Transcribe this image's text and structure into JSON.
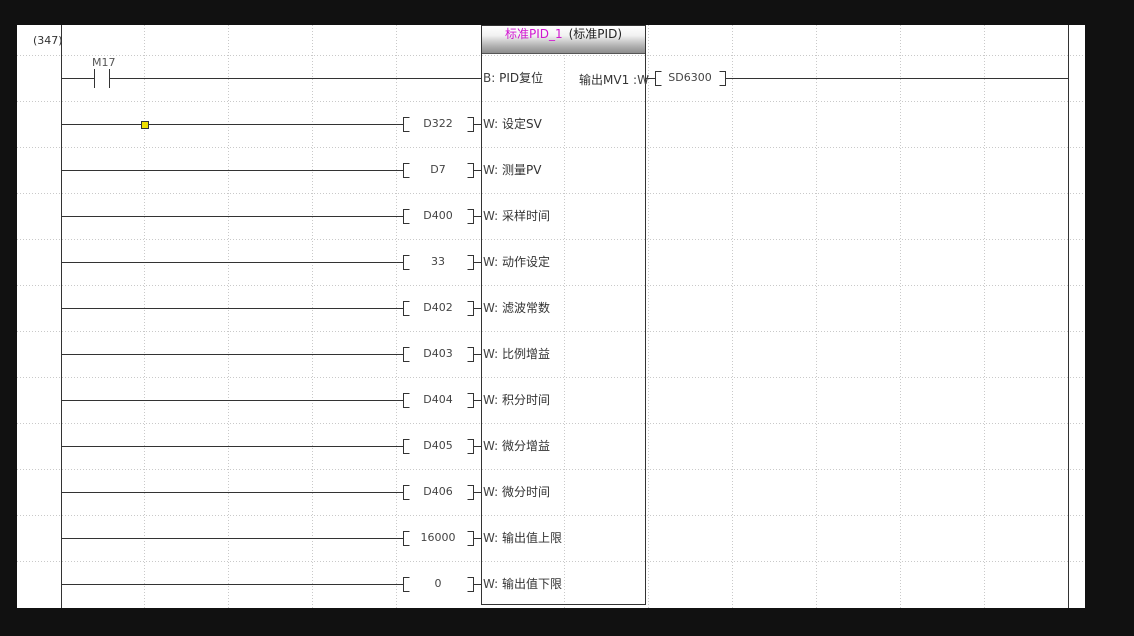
{
  "ladder": {
    "step_number": "(347)",
    "contact": {
      "device": "M17"
    },
    "function_block": {
      "instance_name": "标准PID_1",
      "type_label": "(标准PID)",
      "input_b": {
        "prefix": "B:",
        "label": "PID复位"
      },
      "output": {
        "label": "输出MV1",
        "suffix": ":W",
        "device": "SD6300"
      }
    },
    "inputs": [
      {
        "device": "D322",
        "prefix": "W:",
        "label": "设定SV"
      },
      {
        "device": "D7",
        "prefix": "W:",
        "label": "测量PV"
      },
      {
        "device": "D400",
        "prefix": "W:",
        "label": "采样时间"
      },
      {
        "device": "33",
        "prefix": "W:",
        "label": "动作设定"
      },
      {
        "device": "D402",
        "prefix": "W:",
        "label": "滤波常数"
      },
      {
        "device": "D403",
        "prefix": "W:",
        "label": "比例增益"
      },
      {
        "device": "D404",
        "prefix": "W:",
        "label": "积分时间"
      },
      {
        "device": "D405",
        "prefix": "W:",
        "label": "微分增益"
      },
      {
        "device": "D406",
        "prefix": "W:",
        "label": "微分时间"
      },
      {
        "device": "16000",
        "prefix": "W:",
        "label": "输出值上限"
      },
      {
        "device": "0",
        "prefix": "W:",
        "label": "输出值下限"
      }
    ]
  }
}
